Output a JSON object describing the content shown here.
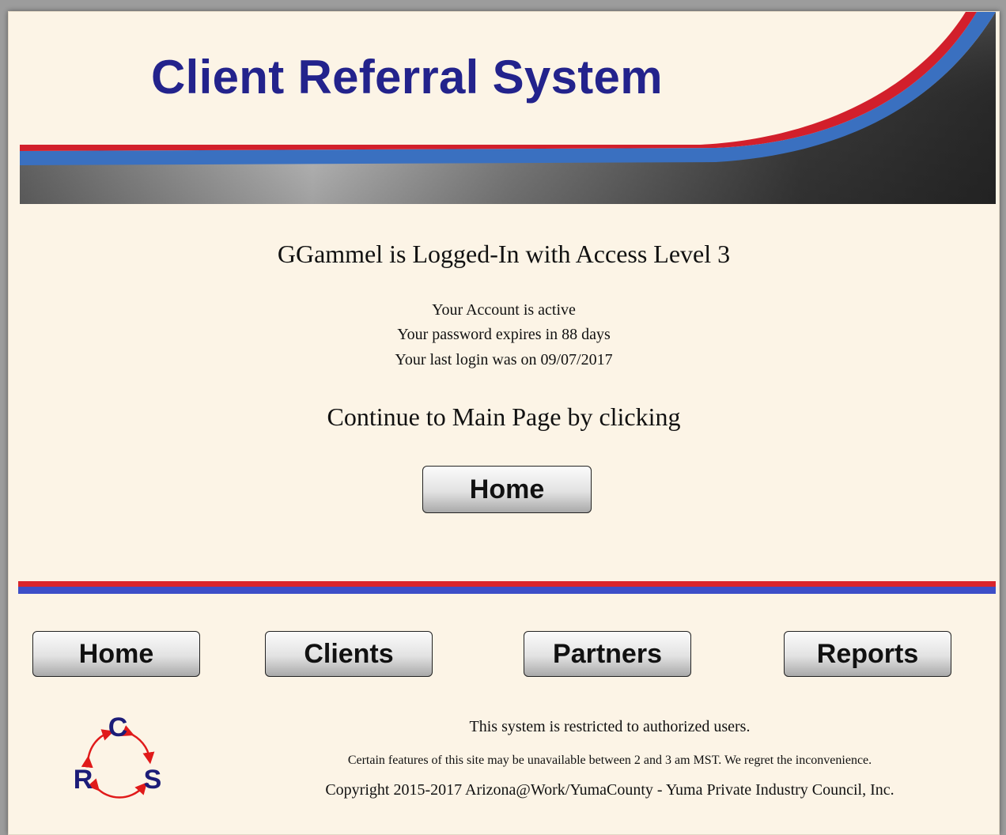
{
  "header": {
    "title": "Client Referral System"
  },
  "status": {
    "login_message": "GGammel is Logged-In with Access Level 3",
    "account_status": "Your Account is active",
    "password_expiry": "Your password expires in 88 days",
    "last_login": "Your last login was on 09/07/2017",
    "continue_message": "Continue to Main Page by clicking"
  },
  "main_button": {
    "label": "Home"
  },
  "nav": {
    "home": "Home",
    "clients": "Clients",
    "partners": "Partners",
    "reports": "Reports"
  },
  "logo": {
    "letters": [
      "C",
      "R",
      "S"
    ]
  },
  "footer": {
    "restricted": "This system is restricted to authorized users.",
    "maintenance": "Certain features of this site may be unavailable between 2 and 3 am MST. We regret the inconvenience.",
    "copyright": "Copyright 2015-2017 Arizona@Work/YumaCounty - Yuma Private Industry Council, Inc."
  },
  "colors": {
    "title": "#23238c",
    "accent_red": "#d9262c",
    "accent_blue": "#3d4fc8",
    "background": "#fcf4e6"
  }
}
